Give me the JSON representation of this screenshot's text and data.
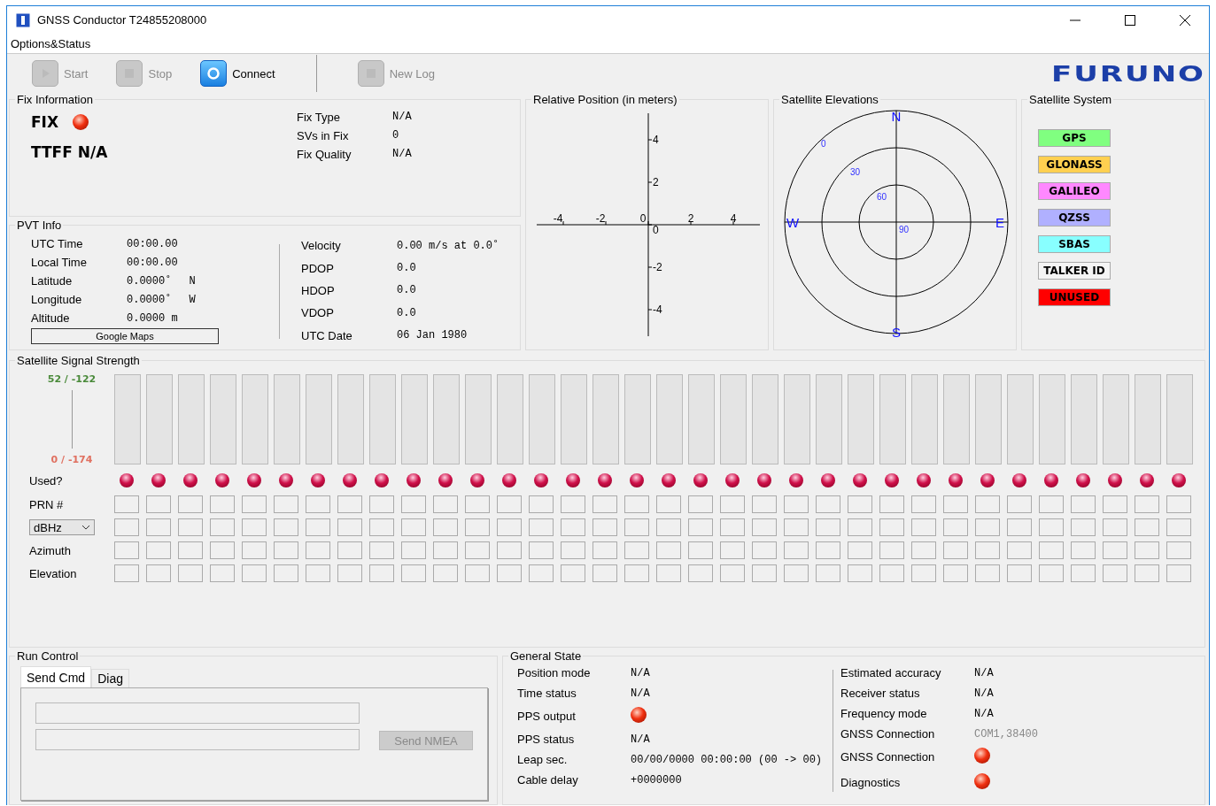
{
  "window": {
    "title": "GNSS Conductor T24855208000"
  },
  "menu": [
    "Options&Status"
  ],
  "toolbar": [
    {
      "kind": "start",
      "label": "Start",
      "disabled": true
    },
    {
      "kind": "stop",
      "label": "Stop",
      "disabled": true
    },
    {
      "kind": "connect",
      "label": "Connect",
      "disabled": false
    },
    {
      "kind": "log",
      "label": "New Log",
      "disabled": true
    }
  ],
  "logo": "FURUNO",
  "fix_information": {
    "title": "Fix Information",
    "fix_label": "FIX",
    "fix_ok": false,
    "ttff": "TTFF N/A",
    "fields": [
      {
        "label": "Fix Type",
        "value": "N/A"
      },
      {
        "label": "SVs in Fix",
        "value": "0"
      },
      {
        "label": "Fix Quality",
        "value": "N/A"
      }
    ]
  },
  "pvt_info": {
    "title": "PVT Info",
    "left": [
      {
        "label": "UTC Time",
        "value": "00:00.00"
      },
      {
        "label": "Local Time",
        "value": "00:00.00"
      },
      {
        "label": "Latitude",
        "value": "0.0000˚",
        "suffix": "N"
      },
      {
        "label": "Longitude",
        "value": "0.0000˚",
        "suffix": "W"
      },
      {
        "label": "Altitude",
        "value": "0.0000 m"
      }
    ],
    "button": "Google Maps",
    "right": [
      {
        "label": "Velocity",
        "value": "0.00 m/s at 0.0˚"
      },
      {
        "label": "PDOP",
        "value": "0.0"
      },
      {
        "label": "HDOP",
        "value": "0.0"
      },
      {
        "label": "VDOP",
        "value": "0.0"
      },
      {
        "label": "UTC Date",
        "value": "06 Jan 1980"
      }
    ]
  },
  "relative_position": {
    "title": "Relative Position (in meters)",
    "x_ticks": [
      "-4",
      "-2",
      "0",
      "2",
      "4"
    ],
    "y_ticks": [
      "4",
      "2",
      "0",
      "-2",
      "-4"
    ]
  },
  "satellite_elevations": {
    "title": "Satellite Elevations",
    "compass": [
      "N",
      "E",
      "S",
      "W"
    ],
    "rings": [
      "0",
      "30",
      "60",
      "90"
    ]
  },
  "satellite_system": {
    "title": "Satellite System",
    "items": [
      {
        "label": "GPS",
        "color": "#80ff80"
      },
      {
        "label": "GLONASS",
        "color": "#ffd050"
      },
      {
        "label": "GALILEO",
        "color": "#ff88ff"
      },
      {
        "label": "QZSS",
        "color": "#b0b0ff"
      },
      {
        "label": "SBAS",
        "color": "#88ffff"
      },
      {
        "label": "TALKER ID",
        "color": "#f4f4f4"
      },
      {
        "label": "UNUSED",
        "color": "#ff0000"
      }
    ]
  },
  "signal_strength": {
    "title": "Satellite Signal Strength",
    "scale_top": "52 / -122",
    "scale_bottom": "0 / -174",
    "row_labels": {
      "used": "Used?",
      "prn": "PRN #",
      "unit": "dBHz",
      "azimuth": "Azimuth",
      "elevation": "Elevation"
    },
    "satellites": [
      {
        "used": false
      },
      {
        "used": false
      },
      {
        "used": false
      },
      {
        "used": false
      },
      {
        "used": false
      },
      {
        "used": false
      },
      {
        "used": false
      },
      {
        "used": false
      },
      {
        "used": false
      },
      {
        "used": false
      },
      {
        "used": false
      },
      {
        "used": false
      },
      {
        "used": false
      },
      {
        "used": false
      },
      {
        "used": false
      },
      {
        "used": false
      },
      {
        "used": false
      },
      {
        "used": false
      },
      {
        "used": false
      },
      {
        "used": false
      },
      {
        "used": false
      },
      {
        "used": false
      },
      {
        "used": false
      },
      {
        "used": false
      },
      {
        "used": false
      },
      {
        "used": false
      },
      {
        "used": false
      },
      {
        "used": false
      },
      {
        "used": false
      },
      {
        "used": false
      },
      {
        "used": false
      },
      {
        "used": false
      },
      {
        "used": false
      },
      {
        "used": false
      }
    ]
  },
  "run_control": {
    "title": "Run Control",
    "tabs": [
      {
        "label": "Send Cmd",
        "selected": true
      },
      {
        "label": "Diag",
        "selected": false
      }
    ],
    "send_button": {
      "label": "Send NMEA",
      "disabled": true
    }
  },
  "general_state": {
    "title": "General State",
    "left": [
      {
        "kind": "text",
        "label": "Position mode",
        "value": "N/A"
      },
      {
        "kind": "text",
        "label": "Time status",
        "value": "N/A"
      },
      {
        "kind": "led",
        "label": "PPS output",
        "ok": false
      },
      {
        "kind": "text",
        "label": "PPS status",
        "value": "N/A"
      },
      {
        "kind": "text",
        "label": "Leap sec.",
        "value": "00/00/0000 00:00:00 (00 -> 00)"
      },
      {
        "kind": "text",
        "label": "Cable delay",
        "value": "+0000000"
      }
    ],
    "right": [
      {
        "kind": "text",
        "label": "Estimated accuracy",
        "value": "N/A"
      },
      {
        "kind": "text",
        "label": "Receiver status",
        "value": "N/A"
      },
      {
        "kind": "text",
        "label": "Frequency mode",
        "value": "N/A"
      },
      {
        "kind": "muted",
        "label": "GNSS Connection",
        "value": "COM1,38400"
      },
      {
        "kind": "led",
        "label": "GNSS Connection",
        "ok": false
      },
      {
        "kind": "led",
        "label": "Diagnostics",
        "ok": false
      }
    ]
  }
}
